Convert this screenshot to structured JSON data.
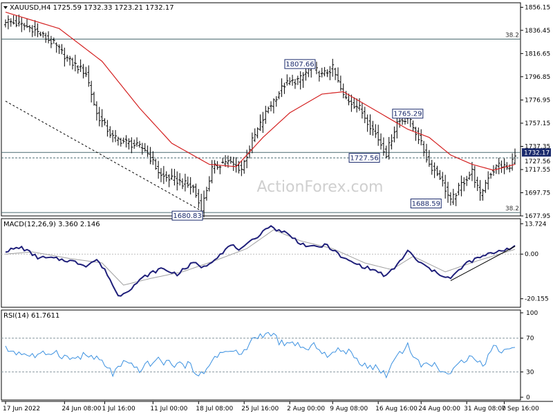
{
  "chart_data": [
    {
      "type": "line",
      "title": "XAUUSD,H4  1725.59 1732.33 1723.21 1732.17",
      "series_kind": "price-bars-with-moving-average",
      "price_ylim": [
        1677.95,
        1860
      ],
      "yticks": [
        "1856.15",
        "1836.45",
        "1816.65",
        "1796.85",
        "1776.95",
        "1757.15",
        "1737.35",
        "1717.55",
        "1697.75",
        "1677.95"
      ],
      "last_price_label": "1732.17",
      "price_anchors": [
        {
          "bar": 0,
          "close": 1845
        },
        {
          "bar": 10,
          "close": 1838
        },
        {
          "bar": 18,
          "close": 1825
        },
        {
          "bar": 24,
          "close": 1810
        },
        {
          "bar": 30,
          "close": 1800
        },
        {
          "bar": 34,
          "close": 1765
        },
        {
          "bar": 40,
          "close": 1745
        },
        {
          "bar": 46,
          "close": 1740
        },
        {
          "bar": 52,
          "close": 1735
        },
        {
          "bar": 58,
          "close": 1712
        },
        {
          "bar": 64,
          "close": 1708
        },
        {
          "bar": 70,
          "close": 1702
        },
        {
          "bar": 73,
          "close": 1683
        },
        {
          "bar": 77,
          "close": 1718
        },
        {
          "bar": 82,
          "close": 1725
        },
        {
          "bar": 88,
          "close": 1718
        },
        {
          "bar": 92,
          "close": 1742
        },
        {
          "bar": 98,
          "close": 1770
        },
        {
          "bar": 104,
          "close": 1790
        },
        {
          "bar": 110,
          "close": 1795
        },
        {
          "bar": 114,
          "close": 1806
        },
        {
          "bar": 118,
          "close": 1798
        },
        {
          "bar": 122,
          "close": 1804
        },
        {
          "bar": 126,
          "close": 1780
        },
        {
          "bar": 132,
          "close": 1770
        },
        {
          "bar": 138,
          "close": 1748
        },
        {
          "bar": 142,
          "close": 1731
        },
        {
          "bar": 146,
          "close": 1758
        },
        {
          "bar": 150,
          "close": 1762
        },
        {
          "bar": 154,
          "close": 1745
        },
        {
          "bar": 158,
          "close": 1722
        },
        {
          "bar": 162,
          "close": 1712
        },
        {
          "bar": 166,
          "close": 1690
        },
        {
          "bar": 170,
          "close": 1705
        },
        {
          "bar": 174,
          "close": 1716
        },
        {
          "bar": 177,
          "close": 1695
        },
        {
          "bar": 180,
          "close": 1712
        },
        {
          "bar": 184,
          "close": 1722
        },
        {
          "bar": 188,
          "close": 1718
        },
        {
          "bar": 190,
          "close": 1732
        }
      ],
      "moving_average_anchors": [
        {
          "bar": 0,
          "value": 1852
        },
        {
          "bar": 20,
          "value": 1838
        },
        {
          "bar": 36,
          "value": 1810
        },
        {
          "bar": 50,
          "value": 1770
        },
        {
          "bar": 62,
          "value": 1740
        },
        {
          "bar": 76,
          "value": 1722
        },
        {
          "bar": 86,
          "value": 1720
        },
        {
          "bar": 96,
          "value": 1745
        },
        {
          "bar": 106,
          "value": 1766
        },
        {
          "bar": 118,
          "value": 1782
        },
        {
          "bar": 126,
          "value": 1784
        },
        {
          "bar": 138,
          "value": 1768
        },
        {
          "bar": 150,
          "value": 1752
        },
        {
          "bar": 158,
          "value": 1745
        },
        {
          "bar": 166,
          "value": 1730
        },
        {
          "bar": 174,
          "value": 1722
        },
        {
          "bar": 182,
          "value": 1717
        },
        {
          "bar": 190,
          "value": 1722
        }
      ],
      "annotations": [
        {
          "label": "1807.66",
          "bar": 116,
          "value": 1807.66
        },
        {
          "label": "1765.29",
          "bar": 150,
          "value": 1765.29
        },
        {
          "label": "1727.56",
          "bar": 140,
          "value": 1727.56
        },
        {
          "label": "1688.59",
          "bar": 163,
          "value": 1688.59
        },
        {
          "label": "1680.83",
          "bar": 74,
          "value": 1680.83
        }
      ],
      "horizontal_levels": [
        {
          "value": 1829,
          "label": "38.2",
          "style": "solid"
        },
        {
          "value": 1727.56,
          "label": "1727.56",
          "style": "dashed"
        },
        {
          "value": 1732.17,
          "label": "",
          "style": "solid"
        },
        {
          "value": 1680.83,
          "label": "38.2",
          "style": "solid"
        }
      ],
      "trendlines": [
        {
          "from": {
            "bar": 0,
            "value": 1776
          },
          "to": {
            "bar": 74,
            "value": 1681
          },
          "style": "dashed"
        }
      ],
      "watermark": "ActionForex.com",
      "colors": {
        "price": "#000000",
        "moving_average": "#d42020",
        "levels": "#4a6a70",
        "watermark": "#cfcfcf"
      }
    },
    {
      "type": "line",
      "title": "MACD(12,26,9) 3.360 2.146",
      "ylim": [
        -24,
        16
      ],
      "yticks": [
        "13.724",
        "0.00",
        "-20.155"
      ],
      "macd_anchors": [
        {
          "bar": 0,
          "value": 1.5
        },
        {
          "bar": 6,
          "value": 3.0
        },
        {
          "bar": 12,
          "value": -1.5
        },
        {
          "bar": 18,
          "value": -2.0
        },
        {
          "bar": 24,
          "value": -3.0
        },
        {
          "bar": 30,
          "value": -5.0
        },
        {
          "bar": 34,
          "value": -2.5
        },
        {
          "bar": 38,
          "value": -9.0
        },
        {
          "bar": 42,
          "value": -19.0
        },
        {
          "bar": 46,
          "value": -16.0
        },
        {
          "bar": 52,
          "value": -10.0
        },
        {
          "bar": 58,
          "value": -6.5
        },
        {
          "bar": 64,
          "value": -9.0
        },
        {
          "bar": 70,
          "value": -4.0
        },
        {
          "bar": 74,
          "value": -6.0
        },
        {
          "bar": 80,
          "value": 0.0
        },
        {
          "bar": 84,
          "value": 4.0
        },
        {
          "bar": 88,
          "value": 2.0
        },
        {
          "bar": 92,
          "value": 6.0
        },
        {
          "bar": 98,
          "value": 12.5
        },
        {
          "bar": 104,
          "value": 10.0
        },
        {
          "bar": 110,
          "value": 5.0
        },
        {
          "bar": 114,
          "value": 3.0
        },
        {
          "bar": 120,
          "value": 4.0
        },
        {
          "bar": 126,
          "value": -2.0
        },
        {
          "bar": 132,
          "value": -5.0
        },
        {
          "bar": 138,
          "value": -7.5
        },
        {
          "bar": 142,
          "value": -10.0
        },
        {
          "bar": 146,
          "value": -5.0
        },
        {
          "bar": 150,
          "value": 1.5
        },
        {
          "bar": 154,
          "value": -3.5
        },
        {
          "bar": 160,
          "value": -8.0
        },
        {
          "bar": 166,
          "value": -11.0
        },
        {
          "bar": 172,
          "value": -4.0
        },
        {
          "bar": 178,
          "value": -1.0
        },
        {
          "bar": 184,
          "value": 1.5
        },
        {
          "bar": 190,
          "value": 3.36
        }
      ],
      "signal_anchors": [
        {
          "bar": 0,
          "value": 0.0
        },
        {
          "bar": 10,
          "value": 1.0
        },
        {
          "bar": 24,
          "value": -2.0
        },
        {
          "bar": 36,
          "value": -4.0
        },
        {
          "bar": 44,
          "value": -14.0
        },
        {
          "bar": 54,
          "value": -11.0
        },
        {
          "bar": 66,
          "value": -8.0
        },
        {
          "bar": 78,
          "value": -3.0
        },
        {
          "bar": 90,
          "value": 2.5
        },
        {
          "bar": 100,
          "value": 11.0
        },
        {
          "bar": 110,
          "value": 6.0
        },
        {
          "bar": 122,
          "value": 2.5
        },
        {
          "bar": 134,
          "value": -4.0
        },
        {
          "bar": 144,
          "value": -7.0
        },
        {
          "bar": 152,
          "value": -1.0
        },
        {
          "bar": 164,
          "value": -8.0
        },
        {
          "bar": 176,
          "value": -3.0
        },
        {
          "bar": 190,
          "value": 2.146
        }
      ],
      "trendline": {
        "from": {
          "bar": 166,
          "value": -12.0
        },
        "to": {
          "bar": 190,
          "value": 3.5
        }
      },
      "colors": {
        "macd": "#1f1f7a",
        "signal": "#a0a0a0"
      }
    },
    {
      "type": "line",
      "title": "RSI(14) 61.7611",
      "ylim": [
        0,
        100
      ],
      "yticks": [
        "100",
        "70",
        "30",
        "0"
      ],
      "levels": [
        70,
        30
      ],
      "rsi_anchors": [
        {
          "bar": 0,
          "value": 57
        },
        {
          "bar": 6,
          "value": 52
        },
        {
          "bar": 12,
          "value": 48
        },
        {
          "bar": 18,
          "value": 55
        },
        {
          "bar": 24,
          "value": 45
        },
        {
          "bar": 30,
          "value": 50
        },
        {
          "bar": 36,
          "value": 42
        },
        {
          "bar": 40,
          "value": 28
        },
        {
          "bar": 44,
          "value": 40
        },
        {
          "bar": 50,
          "value": 33
        },
        {
          "bar": 56,
          "value": 44
        },
        {
          "bar": 62,
          "value": 40
        },
        {
          "bar": 68,
          "value": 38
        },
        {
          "bar": 74,
          "value": 25
        },
        {
          "bar": 78,
          "value": 50
        },
        {
          "bar": 84,
          "value": 55
        },
        {
          "bar": 88,
          "value": 50
        },
        {
          "bar": 92,
          "value": 68
        },
        {
          "bar": 96,
          "value": 75
        },
        {
          "bar": 100,
          "value": 73
        },
        {
          "bar": 104,
          "value": 60
        },
        {
          "bar": 108,
          "value": 65
        },
        {
          "bar": 112,
          "value": 55
        },
        {
          "bar": 116,
          "value": 62
        },
        {
          "bar": 120,
          "value": 48
        },
        {
          "bar": 126,
          "value": 58
        },
        {
          "bar": 132,
          "value": 42
        },
        {
          "bar": 138,
          "value": 35
        },
        {
          "bar": 142,
          "value": 27
        },
        {
          "bar": 146,
          "value": 50
        },
        {
          "bar": 150,
          "value": 62
        },
        {
          "bar": 154,
          "value": 40
        },
        {
          "bar": 160,
          "value": 38
        },
        {
          "bar": 166,
          "value": 26
        },
        {
          "bar": 170,
          "value": 42
        },
        {
          "bar": 174,
          "value": 52
        },
        {
          "bar": 178,
          "value": 37
        },
        {
          "bar": 182,
          "value": 60
        },
        {
          "bar": 186,
          "value": 55
        },
        {
          "bar": 190,
          "value": 61.76
        }
      ],
      "colors": {
        "rsi": "#3a90e0",
        "levels": "#8a9aa0"
      }
    }
  ],
  "x_axis": {
    "labels": [
      {
        "bar": 0,
        "label": "17 Jun 2022"
      },
      {
        "bar": 22,
        "label": "24 Jun 08:00"
      },
      {
        "bar": 37,
        "label": "1 Jul 16:00"
      },
      {
        "bar": 55,
        "label": "11 Jul 00:00"
      },
      {
        "bar": 72,
        "label": "18 Jul 08:00"
      },
      {
        "bar": 89,
        "label": "25 Jul 16:00"
      },
      {
        "bar": 106,
        "label": "2 Aug 00:00"
      },
      {
        "bar": 122,
        "label": "9 Aug 08:00"
      },
      {
        "bar": 139,
        "label": "16 Aug 16:00"
      },
      {
        "bar": 155,
        "label": "24 Aug 00:00"
      },
      {
        "bar": 172,
        "label": "31 Aug 08:00"
      },
      {
        "bar": 186,
        "label": "7 Sep 16:00"
      }
    ]
  }
}
